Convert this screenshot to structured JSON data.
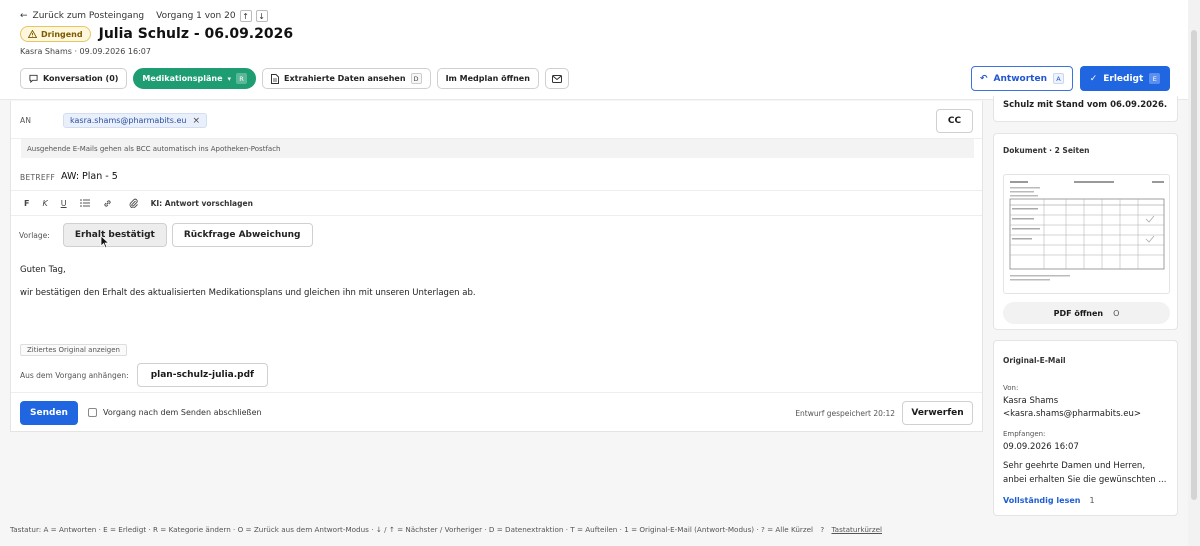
{
  "nav": {
    "back_label": "Zurück zum Posteingang",
    "counter": "Vorgang 1 von 20",
    "prev_glyph": "↑",
    "next_glyph": "↓"
  },
  "case": {
    "badge": "Dringend",
    "title": "Julia Schulz - 06.09.2026",
    "meta": "Kasra Shams · 09.09.2026 16:07"
  },
  "toolbar": {
    "conversation": "Konversation (0)",
    "medplans": "Medikationspläne",
    "medplans_key": "R",
    "extracted": "Extrahierte Daten ansehen",
    "extracted_key": "D",
    "open_medplan": "Im Medplan öffnen",
    "reply": "Antworten",
    "reply_key": "A",
    "done": "Erledigt",
    "done_key": "E"
  },
  "composer": {
    "to_label": "AN",
    "to_chip": "kasra.shams@pharmabits.eu",
    "chip_remove": "×",
    "cc_label": "CC",
    "bcc_note": "Ausgehende E-Mails gehen als BCC automatisch ins Apotheken-Postfach",
    "subject_label": "BETREFF",
    "subject": "AW: Plan - 5",
    "fmt_bold": "F",
    "fmt_italic": "K",
    "fmt_underline": "U",
    "ai_suggest": "KI: Antwort vorschlagen",
    "template_label": "Vorlage:",
    "template_1": "Erhalt bestätigt",
    "template_2": "Rückfrage Abweichung",
    "greeting": "Guten Tag,",
    "body": "wir bestätigen den Erhalt des aktualisierten Medikationsplans und gleichen ihn mit unseren Unterlagen ab.",
    "quoted": "Zitiertes Original anzeigen",
    "attach_label": "Aus dem Vorgang anhängen:",
    "attachment": "plan-schulz-julia.pdf",
    "send": "Senden",
    "close_after": "Vorgang nach dem Senden abschließen",
    "draft_saved": "Entwurf gespeichert 20:12",
    "discard": "Verwerfen"
  },
  "sidebar": {
    "summary_tail": "Schulz mit Stand vom 06.09.2026.",
    "document_header": "Dokument · 2 Seiten",
    "open_pdf": "PDF öffnen",
    "open_pdf_key": "O",
    "original_header": "Original-E-Mail",
    "from_label": "Von:",
    "from_name": "Kasra Shams",
    "from_email": "<kasra.shams@pharmabits.eu>",
    "received_label": "Empfangen:",
    "received": "09.09.2026 16:07",
    "preview_1": "Sehr geehrte Damen und Herren,",
    "preview_2": "anbei erhalten Sie die gewünschten ...",
    "read_more": "Vollständig lesen",
    "read_more_key": "1"
  },
  "footer": {
    "shortcuts": "Tastatur: A = Antworten · E = Erledigt · R = Kategorie ändern · O = Zurück aus dem Antwort-Modus · ↓ / ↑ = Nächster / Vorheriger · D = Datenextraktion · T = Aufteilen · 1 = Original-E-Mail (Antwort-Modus) · ? = Alle Kürzel",
    "help_glyph": "?",
    "help_link": "Tastaturkürzel"
  },
  "colors": {
    "primary": "#1f66e0",
    "green": "#1e9d72",
    "urgent_bg": "#fff7dc"
  }
}
